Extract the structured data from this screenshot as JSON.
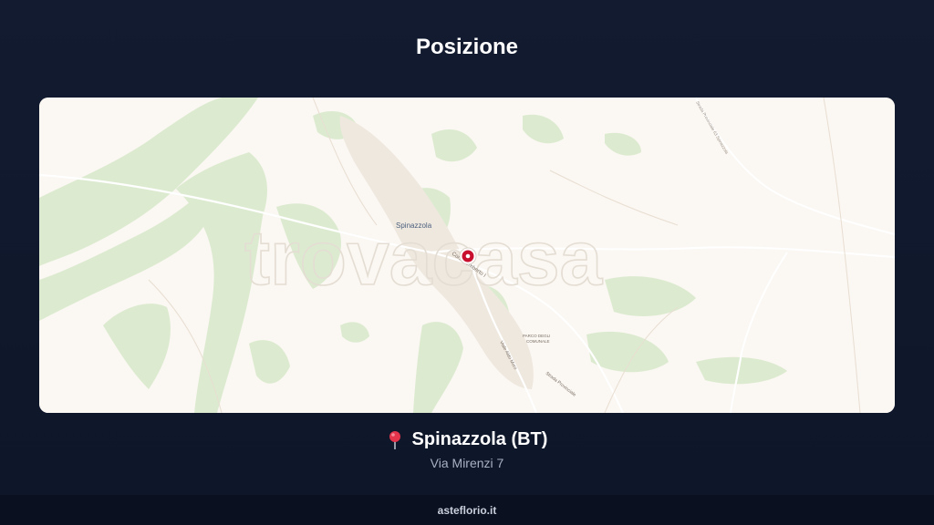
{
  "title": "Posizione",
  "map": {
    "town_label": "Spinazzola",
    "watermark": "trovacasa",
    "street_label_1": "Corso Umberto I",
    "street_label_2": "Viale Aldo Moro",
    "street_label_3": "Strada Provinciale",
    "park_label_1": "PARCO DEGLI",
    "park_label_2": "COMUNALE",
    "road_label_ne": "Strada Provinciale 63 Spinazzola",
    "marker_icon": "map-marker-icon",
    "colors": {
      "land": "#fbf7f2",
      "vegetation": "#dbe9cf",
      "marker": "#c8102e"
    }
  },
  "location": {
    "icon": "pushpin-icon",
    "city": "Spinazzola (BT)",
    "address": "Via Mirenzi 7"
  },
  "footer": {
    "brand": "asteflorio.it"
  }
}
